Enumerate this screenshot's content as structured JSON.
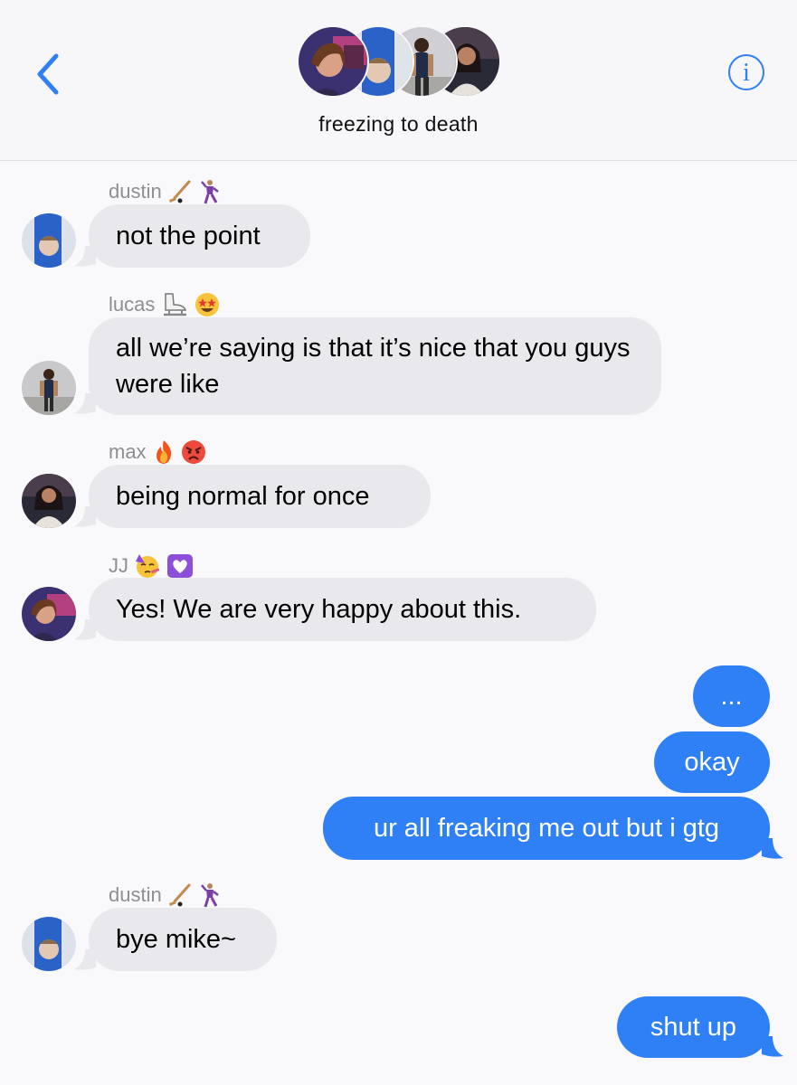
{
  "header": {
    "group_name": "freezing to death",
    "back_icon": "chevron-left-icon",
    "info_icon": "info-icon",
    "info_glyph": "i",
    "accent_color": "#2f7ff5"
  },
  "messages": [
    {
      "sender": "dustin",
      "text": "not the point"
    },
    {
      "sender": "lucas",
      "text": "all we’re saying is that it’s nice that you guys were like"
    },
    {
      "sender": "max",
      "text": "being normal for once"
    },
    {
      "sender": "JJ",
      "text": "Yes! We are very happy about this."
    },
    {
      "from_me": true,
      "text": "..."
    },
    {
      "from_me": true,
      "text": "okay"
    },
    {
      "from_me": true,
      "text": "ur all freaking me out but i gtg"
    },
    {
      "sender": "dustin",
      "text": "bye mike~"
    },
    {
      "from_me": true,
      "text": "shut up"
    }
  ],
  "sender_emojis": {
    "dustin": [
      "hockey-stick-icon",
      "dancing-man-icon"
    ],
    "lucas": [
      "ice-skate-icon",
      "star-struck-icon"
    ],
    "max": [
      "fire-icon",
      "angry-face-icon"
    ],
    "JJ": [
      "partying-face-icon",
      "white-heart-icon"
    ]
  },
  "colors": {
    "incoming_bubble": "#e9e9ed",
    "outgoing_bubble": "#2f7ff5",
    "sender_label": "#8e8e93"
  }
}
